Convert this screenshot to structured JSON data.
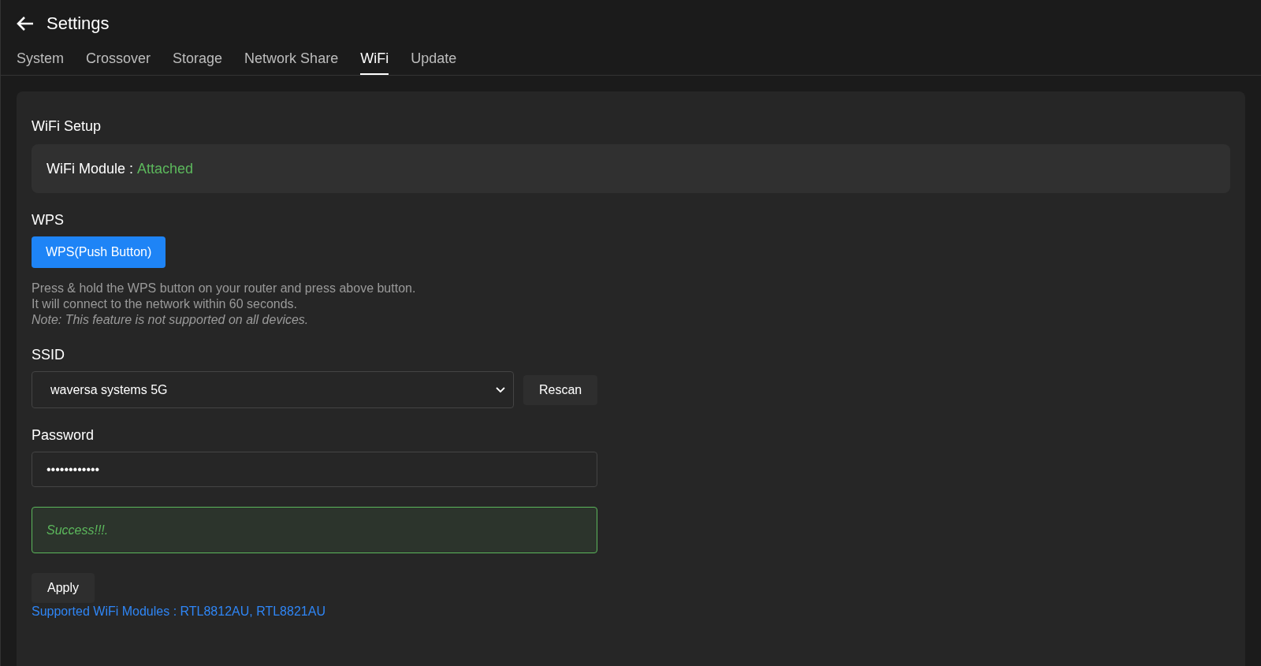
{
  "header": {
    "title": "Settings"
  },
  "tabs": [
    {
      "label": "System",
      "selected": false
    },
    {
      "label": "Crossover",
      "selected": false
    },
    {
      "label": "Storage",
      "selected": false
    },
    {
      "label": "Network Share",
      "selected": false
    },
    {
      "label": "WiFi",
      "selected": true
    },
    {
      "label": "Update",
      "selected": false
    }
  ],
  "wifi_setup": {
    "title": "WiFi Setup",
    "module_label": "WiFi Module :",
    "module_status": "Attached"
  },
  "wps": {
    "label": "WPS",
    "button": "WPS(Push Button)",
    "help": [
      {
        "kind": "plain",
        "text": "Press & hold the WPS button on your router and press above button."
      },
      {
        "kind": "plain",
        "text": "It will connect to the network within 60 seconds."
      },
      {
        "kind": "note",
        "text": "Note: This feature is not supported on all devices."
      }
    ]
  },
  "ssid": {
    "label": "SSID",
    "value": "waversa systems 5G",
    "button": "Rescan"
  },
  "password": {
    "label": "Password",
    "value": "••••••••••••"
  },
  "alert": {
    "kind": "success",
    "message": "Success!!!."
  },
  "apply_button": "Apply",
  "supported_link": "Supported WiFi Modules : RTL8812AU, RTL8821AU"
}
